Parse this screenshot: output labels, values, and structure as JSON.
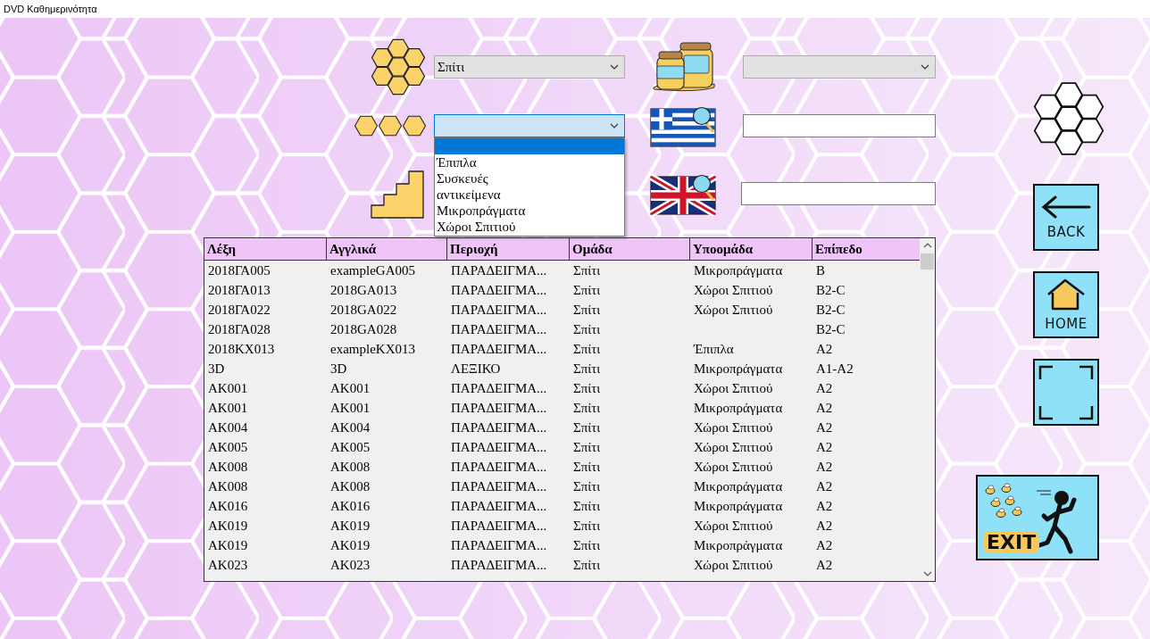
{
  "window": {
    "title": "DVD Καθημερινότητα"
  },
  "filters": {
    "group_select": {
      "value": "Σπίτι",
      "focused": false
    },
    "subgroup_select": {
      "focused": true,
      "open": true,
      "options": [
        {
          "selected": true
        },
        {
          "label": "Έπιπλα",
          "selected": false
        },
        {
          "label": "Συσκευές",
          "selected": false
        },
        {
          "label": "αντικείμενα",
          "selected": false
        },
        {
          "label": "Μικροπράγματα",
          "selected": false
        },
        {
          "label": "Χώροι Σπιτιού",
          "selected": false
        }
      ]
    },
    "source_select": {
      "focused": false
    }
  },
  "table": {
    "columns": [
      "Λέξη",
      "Αγγλικά",
      "Περιοχή",
      "Ομάδα",
      "Υποομάδα",
      "Επίπεδο"
    ],
    "rows": [
      [
        "2018ΓΑ005",
        "exampleGA005",
        "ΠΑΡΑΔΕΙΓΜΑ...",
        "Σπίτι",
        "Μικροπράγματα",
        "B"
      ],
      [
        "2018ΓΑ013",
        "2018GA013",
        "ΠΑΡΑΔΕΙΓΜΑ...",
        "Σπίτι",
        "Χώροι Σπιτιού",
        "B2-C"
      ],
      [
        "2018ΓΑ022",
        "2018GA022",
        "ΠΑΡΑΔΕΙΓΜΑ...",
        "Σπίτι",
        "Χώροι Σπιτιού",
        "B2-C"
      ],
      [
        "2018ΓΑ028",
        "2018GA028",
        "ΠΑΡΑΔΕΙΓΜΑ...",
        "Σπίτι",
        null,
        "B2-C"
      ],
      [
        "2018ΚΧ013",
        "exampleKX013",
        "ΠΑΡΑΔΕΙΓΜΑ...",
        "Σπίτι",
        "Έπιπλα",
        "A2"
      ],
      [
        "3D",
        "3D",
        "ΛΕΞΙΚΟ",
        "Σπίτι",
        "Μικροπράγματα",
        "A1-A2"
      ],
      [
        "ΑΚ001",
        "AK001",
        "ΠΑΡΑΔΕΙΓΜΑ...",
        "Σπίτι",
        "Χώροι Σπιτιού",
        "A2"
      ],
      [
        "ΑΚ001",
        "AK001",
        "ΠΑΡΑΔΕΙΓΜΑ...",
        "Σπίτι",
        "Μικροπράγματα",
        "A2"
      ],
      [
        "ΑΚ004",
        "AK004",
        "ΠΑΡΑΔΕΙΓΜΑ...",
        "Σπίτι",
        "Χώροι Σπιτιού",
        "A2"
      ],
      [
        "ΑΚ005",
        "AK005",
        "ΠΑΡΑΔΕΙΓΜΑ...",
        "Σπίτι",
        "Χώροι Σπιτιού",
        "A2"
      ],
      [
        "ΑΚ008",
        "AK008",
        "ΠΑΡΑΔΕΙΓΜΑ...",
        "Σπίτι",
        "Χώροι Σπιτιού",
        "A2"
      ],
      [
        "ΑΚ008",
        "AK008",
        "ΠΑΡΑΔΕΙΓΜΑ...",
        "Σπίτι",
        "Μικροπράγματα",
        "A2"
      ],
      [
        "ΑΚ016",
        "AK016",
        "ΠΑΡΑΔΕΙΓΜΑ...",
        "Σπίτι",
        "Μικροπράγματα",
        "A2"
      ],
      [
        "ΑΚ019",
        "AK019",
        "ΠΑΡΑΔΕΙΓΜΑ...",
        "Σπίτι",
        "Χώροι Σπιτιού",
        "A2"
      ],
      [
        "ΑΚ019",
        "AK019",
        "ΠΑΡΑΔΕΙΓΜΑ...",
        "Σπίτι",
        "Μικροπράγματα",
        "A2"
      ],
      [
        "ΑΚ023",
        "AK023",
        "ΠΑΡΑΔΕΙΓΜΑ...",
        "Σπίτι",
        "Χώροι Σπιτιού",
        "A2"
      ]
    ]
  },
  "nav_buttons": [
    {
      "kind": "back",
      "label": "BACK"
    },
    {
      "kind": "home",
      "label": "HOME"
    },
    {
      "kind": "fullscreen"
    },
    {
      "kind": "exit",
      "label": "EXIT"
    }
  ]
}
